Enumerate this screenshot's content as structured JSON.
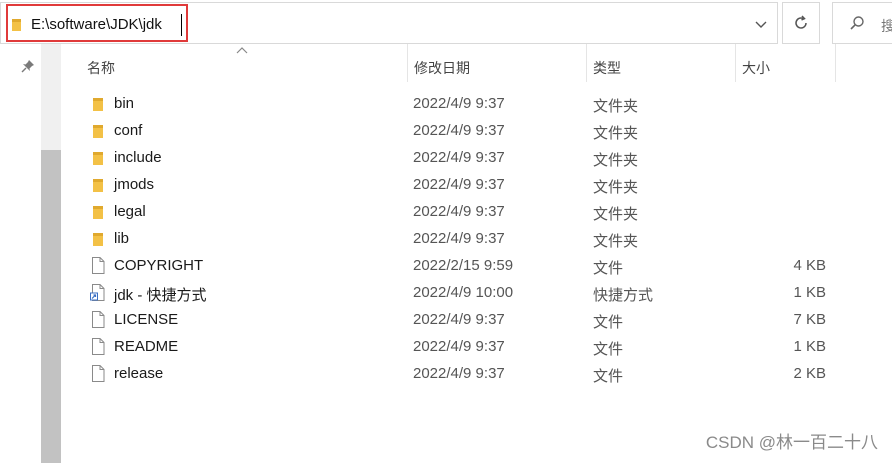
{
  "address_bar": {
    "path": "E:\\software\\JDK\\jdk",
    "dropdown_icon": "chevron-down-icon"
  },
  "toolbar": {
    "refresh_icon": "refresh-icon",
    "search_placeholder": "搜"
  },
  "columns": {
    "name": "名称",
    "date": "修改日期",
    "type": "类型",
    "size": "大小"
  },
  "files": [
    {
      "name": "bin",
      "date": "2022/4/9 9:37",
      "type": "文件夹",
      "size": "",
      "icon": "folder-icon"
    },
    {
      "name": "conf",
      "date": "2022/4/9 9:37",
      "type": "文件夹",
      "size": "",
      "icon": "folder-icon"
    },
    {
      "name": "include",
      "date": "2022/4/9 9:37",
      "type": "文件夹",
      "size": "",
      "icon": "folder-icon"
    },
    {
      "name": "jmods",
      "date": "2022/4/9 9:37",
      "type": "文件夹",
      "size": "",
      "icon": "folder-icon"
    },
    {
      "name": "legal",
      "date": "2022/4/9 9:37",
      "type": "文件夹",
      "size": "",
      "icon": "folder-icon"
    },
    {
      "name": "lib",
      "date": "2022/4/9 9:37",
      "type": "文件夹",
      "size": "",
      "icon": "folder-icon"
    },
    {
      "name": "COPYRIGHT",
      "date": "2022/2/15 9:59",
      "type": "文件",
      "size": "4 KB",
      "icon": "file-icon"
    },
    {
      "name": "jdk - 快捷方式",
      "date": "2022/4/9 10:00",
      "type": "快捷方式",
      "size": "1 KB",
      "icon": "shortcut-icon"
    },
    {
      "name": "LICENSE",
      "date": "2022/4/9 9:37",
      "type": "文件",
      "size": "7 KB",
      "icon": "file-icon"
    },
    {
      "name": "README",
      "date": "2022/4/9 9:37",
      "type": "文件",
      "size": "1 KB",
      "icon": "file-icon"
    },
    {
      "name": "release",
      "date": "2022/4/9 9:37",
      "type": "文件",
      "size": "2 KB",
      "icon": "file-icon"
    }
  ],
  "watermark": "CSDN @林一百二十八",
  "colors": {
    "highlight": "#e03a3a",
    "folder": "#f3c146",
    "scroll_thumb": "#c2c2c2"
  }
}
